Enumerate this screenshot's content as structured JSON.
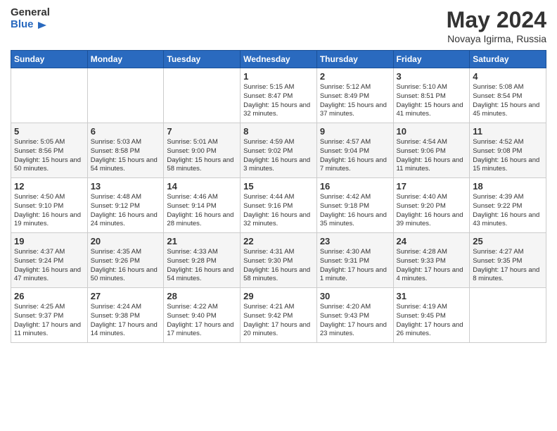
{
  "header": {
    "logo_general": "General",
    "logo_blue": "Blue",
    "month_year": "May 2024",
    "location": "Novaya Igirma, Russia"
  },
  "weekdays": [
    "Sunday",
    "Monday",
    "Tuesday",
    "Wednesday",
    "Thursday",
    "Friday",
    "Saturday"
  ],
  "weeks": [
    [
      {
        "day": "",
        "sunrise": "",
        "sunset": "",
        "daylight": ""
      },
      {
        "day": "",
        "sunrise": "",
        "sunset": "",
        "daylight": ""
      },
      {
        "day": "",
        "sunrise": "",
        "sunset": "",
        "daylight": ""
      },
      {
        "day": "1",
        "sunrise": "Sunrise: 5:15 AM",
        "sunset": "Sunset: 8:47 PM",
        "daylight": "Daylight: 15 hours and 32 minutes."
      },
      {
        "day": "2",
        "sunrise": "Sunrise: 5:12 AM",
        "sunset": "Sunset: 8:49 PM",
        "daylight": "Daylight: 15 hours and 37 minutes."
      },
      {
        "day": "3",
        "sunrise": "Sunrise: 5:10 AM",
        "sunset": "Sunset: 8:51 PM",
        "daylight": "Daylight: 15 hours and 41 minutes."
      },
      {
        "day": "4",
        "sunrise": "Sunrise: 5:08 AM",
        "sunset": "Sunset: 8:54 PM",
        "daylight": "Daylight: 15 hours and 45 minutes."
      }
    ],
    [
      {
        "day": "5",
        "sunrise": "Sunrise: 5:05 AM",
        "sunset": "Sunset: 8:56 PM",
        "daylight": "Daylight: 15 hours and 50 minutes."
      },
      {
        "day": "6",
        "sunrise": "Sunrise: 5:03 AM",
        "sunset": "Sunset: 8:58 PM",
        "daylight": "Daylight: 15 hours and 54 minutes."
      },
      {
        "day": "7",
        "sunrise": "Sunrise: 5:01 AM",
        "sunset": "Sunset: 9:00 PM",
        "daylight": "Daylight: 15 hours and 58 minutes."
      },
      {
        "day": "8",
        "sunrise": "Sunrise: 4:59 AM",
        "sunset": "Sunset: 9:02 PM",
        "daylight": "Daylight: 16 hours and 3 minutes."
      },
      {
        "day": "9",
        "sunrise": "Sunrise: 4:57 AM",
        "sunset": "Sunset: 9:04 PM",
        "daylight": "Daylight: 16 hours and 7 minutes."
      },
      {
        "day": "10",
        "sunrise": "Sunrise: 4:54 AM",
        "sunset": "Sunset: 9:06 PM",
        "daylight": "Daylight: 16 hours and 11 minutes."
      },
      {
        "day": "11",
        "sunrise": "Sunrise: 4:52 AM",
        "sunset": "Sunset: 9:08 PM",
        "daylight": "Daylight: 16 hours and 15 minutes."
      }
    ],
    [
      {
        "day": "12",
        "sunrise": "Sunrise: 4:50 AM",
        "sunset": "Sunset: 9:10 PM",
        "daylight": "Daylight: 16 hours and 19 minutes."
      },
      {
        "day": "13",
        "sunrise": "Sunrise: 4:48 AM",
        "sunset": "Sunset: 9:12 PM",
        "daylight": "Daylight: 16 hours and 24 minutes."
      },
      {
        "day": "14",
        "sunrise": "Sunrise: 4:46 AM",
        "sunset": "Sunset: 9:14 PM",
        "daylight": "Daylight: 16 hours and 28 minutes."
      },
      {
        "day": "15",
        "sunrise": "Sunrise: 4:44 AM",
        "sunset": "Sunset: 9:16 PM",
        "daylight": "Daylight: 16 hours and 32 minutes."
      },
      {
        "day": "16",
        "sunrise": "Sunrise: 4:42 AM",
        "sunset": "Sunset: 9:18 PM",
        "daylight": "Daylight: 16 hours and 35 minutes."
      },
      {
        "day": "17",
        "sunrise": "Sunrise: 4:40 AM",
        "sunset": "Sunset: 9:20 PM",
        "daylight": "Daylight: 16 hours and 39 minutes."
      },
      {
        "day": "18",
        "sunrise": "Sunrise: 4:39 AM",
        "sunset": "Sunset: 9:22 PM",
        "daylight": "Daylight: 16 hours and 43 minutes."
      }
    ],
    [
      {
        "day": "19",
        "sunrise": "Sunrise: 4:37 AM",
        "sunset": "Sunset: 9:24 PM",
        "daylight": "Daylight: 16 hours and 47 minutes."
      },
      {
        "day": "20",
        "sunrise": "Sunrise: 4:35 AM",
        "sunset": "Sunset: 9:26 PM",
        "daylight": "Daylight: 16 hours and 50 minutes."
      },
      {
        "day": "21",
        "sunrise": "Sunrise: 4:33 AM",
        "sunset": "Sunset: 9:28 PM",
        "daylight": "Daylight: 16 hours and 54 minutes."
      },
      {
        "day": "22",
        "sunrise": "Sunrise: 4:31 AM",
        "sunset": "Sunset: 9:30 PM",
        "daylight": "Daylight: 16 hours and 58 minutes."
      },
      {
        "day": "23",
        "sunrise": "Sunrise: 4:30 AM",
        "sunset": "Sunset: 9:31 PM",
        "daylight": "Daylight: 17 hours and 1 minute."
      },
      {
        "day": "24",
        "sunrise": "Sunrise: 4:28 AM",
        "sunset": "Sunset: 9:33 PM",
        "daylight": "Daylight: 17 hours and 4 minutes."
      },
      {
        "day": "25",
        "sunrise": "Sunrise: 4:27 AM",
        "sunset": "Sunset: 9:35 PM",
        "daylight": "Daylight: 17 hours and 8 minutes."
      }
    ],
    [
      {
        "day": "26",
        "sunrise": "Sunrise: 4:25 AM",
        "sunset": "Sunset: 9:37 PM",
        "daylight": "Daylight: 17 hours and 11 minutes."
      },
      {
        "day": "27",
        "sunrise": "Sunrise: 4:24 AM",
        "sunset": "Sunset: 9:38 PM",
        "daylight": "Daylight: 17 hours and 14 minutes."
      },
      {
        "day": "28",
        "sunrise": "Sunrise: 4:22 AM",
        "sunset": "Sunset: 9:40 PM",
        "daylight": "Daylight: 17 hours and 17 minutes."
      },
      {
        "day": "29",
        "sunrise": "Sunrise: 4:21 AM",
        "sunset": "Sunset: 9:42 PM",
        "daylight": "Daylight: 17 hours and 20 minutes."
      },
      {
        "day": "30",
        "sunrise": "Sunrise: 4:20 AM",
        "sunset": "Sunset: 9:43 PM",
        "daylight": "Daylight: 17 hours and 23 minutes."
      },
      {
        "day": "31",
        "sunrise": "Sunrise: 4:19 AM",
        "sunset": "Sunset: 9:45 PM",
        "daylight": "Daylight: 17 hours and 26 minutes."
      },
      {
        "day": "",
        "sunrise": "",
        "sunset": "",
        "daylight": ""
      }
    ]
  ]
}
